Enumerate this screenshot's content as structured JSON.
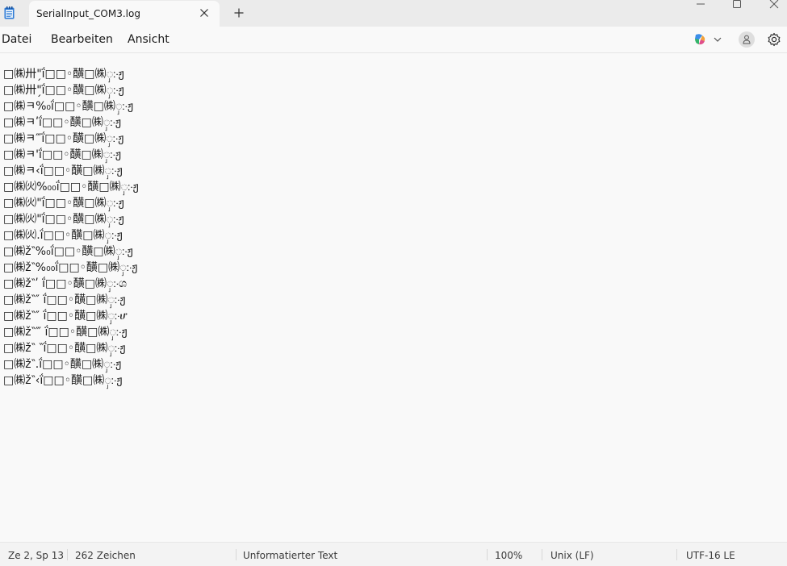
{
  "tab": {
    "title": "SerialInput_COM3.log"
  },
  "menu": {
    "file": "Datei",
    "edit": "Bearbeiten",
    "view": "Ansicht"
  },
  "icons": {
    "app": "notepad-icon",
    "close": "close-icon",
    "new_tab": "plus-icon",
    "minimize": "minimize-icon",
    "maximize": "maximize-icon",
    "window_close": "close-icon",
    "copilot": "copilot-icon",
    "dropdown": "chevron-down-icon",
    "account": "account-icon",
    "settings": "gear-icon"
  },
  "editor": {
    "lines": [
      "□㈱卅\"̗ḯ□□◦䤑□㈱ှ჻ჟ",
      "□㈱卅\"̗ḯ□□◦䤑□㈱ှ჻ჟ",
      "□㈱ㅋ%₀ḯ□□◦䤑□㈱ှ჻ჟ",
      "□㈱ㅋʹḯ□□◦䤑□㈱ှ჻ჟ",
      "□㈱ㅋ‴ḯ□□◦䤑□㈱ှ჻ჟ",
      "□㈱ㅋ'ḯ□□◦䤑□㈱ှ჻ჟ",
      "□㈱ㅋ‹ḯ□□◦䤑□㈱ှ჻ჟ",
      "□㈱㈫%₀₀ḯ□□◦䤑□㈱ှ჻ჟ",
      "□㈱㈫\"ḯ□□◦䤑□㈱ှ჻ჟ",
      "□㈱㈫\"ḯ□□◦䤑□㈱ှ჻ჟ",
      "□㈱㈫.ḯ□□◦䤑□㈱ှ჻ჟ",
      "□㈱ž‶%₀ḯ□□◦䤑□㈱ှ჻ჟ",
      "□㈱ž‶%₀₀ḯ□□◦䤑□㈱ှ჻ჟ",
      "□㈱ž‶ʹ ḯ□□◦䤑□㈱ှ჻ශ",
      "□㈱ž‶″ ḯ□□◦䤑□㈱ှ჻ჟ",
      "□㈱ž‶″ ḯ□□◦䤑□㈱ှ჻ሆ",
      "□㈱ž‶‴ ḯ□□◦䤑□㈱ှ჻ჟ",
      "□㈱ž‶ ‶ḯ□□◦䤑□㈱ှ჻ჟ",
      "□㈱ž‶.ḯ□□◦䤑□㈱ှ჻ჟ",
      "□㈱ž‶‹ḯ□□◦䤑□㈱ှ჻ჟ"
    ]
  },
  "status": {
    "position": "Ze 2, Sp 13",
    "chars": "262 Zeichen",
    "format": "Unformatierter Text",
    "zoom": "100%",
    "line_ending": "Unix (LF)",
    "encoding": "UTF-16 LE"
  }
}
